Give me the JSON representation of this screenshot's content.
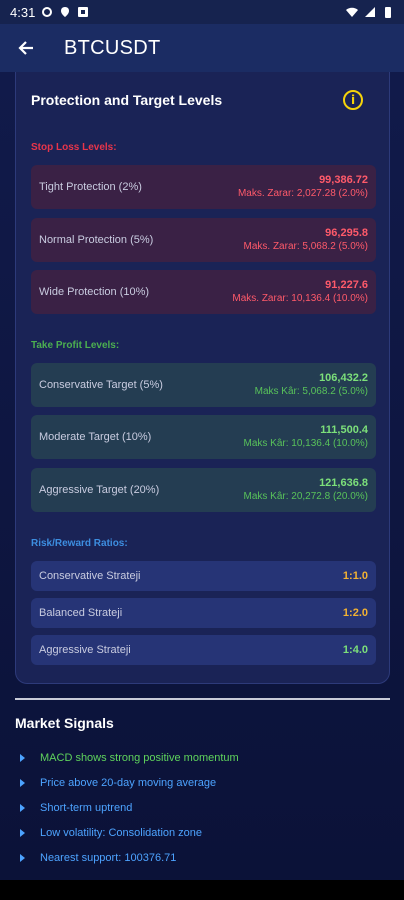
{
  "status_bar": {
    "time": "4:31"
  },
  "app_bar": {
    "title": "BTCUSDT",
    "back_icon": "arrow-left-icon"
  },
  "card": {
    "title": "Protection and Target Levels",
    "info_icon": "info-icon",
    "stop_loss": {
      "label": "Stop Loss Levels:",
      "color": "#e8354a",
      "items": [
        {
          "name": "Tight Protection (2%)",
          "price": "99,386.72",
          "detail": "Maks. Zarar: 2,027.28 (2.0%)"
        },
        {
          "name": "Normal Protection (5%)",
          "price": "96,295.8",
          "detail": "Maks. Zarar: 5,068.2 (5.0%)"
        },
        {
          "name": "Wide Protection (10%)",
          "price": "91,227.6",
          "detail": "Maks. Zarar: 10,136.4 (10.0%)"
        }
      ]
    },
    "take_profit": {
      "label": "Take Profit Levels:",
      "color": "#4caf50",
      "items": [
        {
          "name": "Conservative Target (5%)",
          "price": "106,432.2",
          "detail": "Maks Kâr: 5,068.2 (5.0%)"
        },
        {
          "name": "Moderate Target (10%)",
          "price": "111,500.4",
          "detail": "Maks Kâr: 10,136.4 (10.0%)"
        },
        {
          "name": "Aggressive Target (20%)",
          "price": "121,636.8",
          "detail": "Maks Kâr: 20,272.8 (20.0%)"
        }
      ]
    },
    "risk_reward": {
      "label": "Risk/Reward Ratios:",
      "color": "#3d8ee0",
      "items": [
        {
          "name": "Conservative Strateji",
          "ratio": "1:1.0",
          "color": "#f2b233"
        },
        {
          "name": "Balanced Strateji",
          "ratio": "1:2.0",
          "color": "#f2b233"
        },
        {
          "name": "Aggressive Strateji",
          "ratio": "1:4.0",
          "color": "#7ce07a"
        }
      ]
    }
  },
  "market_signals": {
    "title": "Market Signals",
    "items": [
      {
        "text": "MACD shows strong positive momentum",
        "color": "#5fd35c"
      },
      {
        "text": "Price above 20-day moving average",
        "color": "#4da3ff"
      },
      {
        "text": "Short-term uptrend",
        "color": "#4da3ff"
      },
      {
        "text": "Low volatility: Consolidation zone",
        "color": "#4da3ff"
      },
      {
        "text": "Nearest support: 100376.71",
        "color": "#4da3ff"
      }
    ]
  }
}
